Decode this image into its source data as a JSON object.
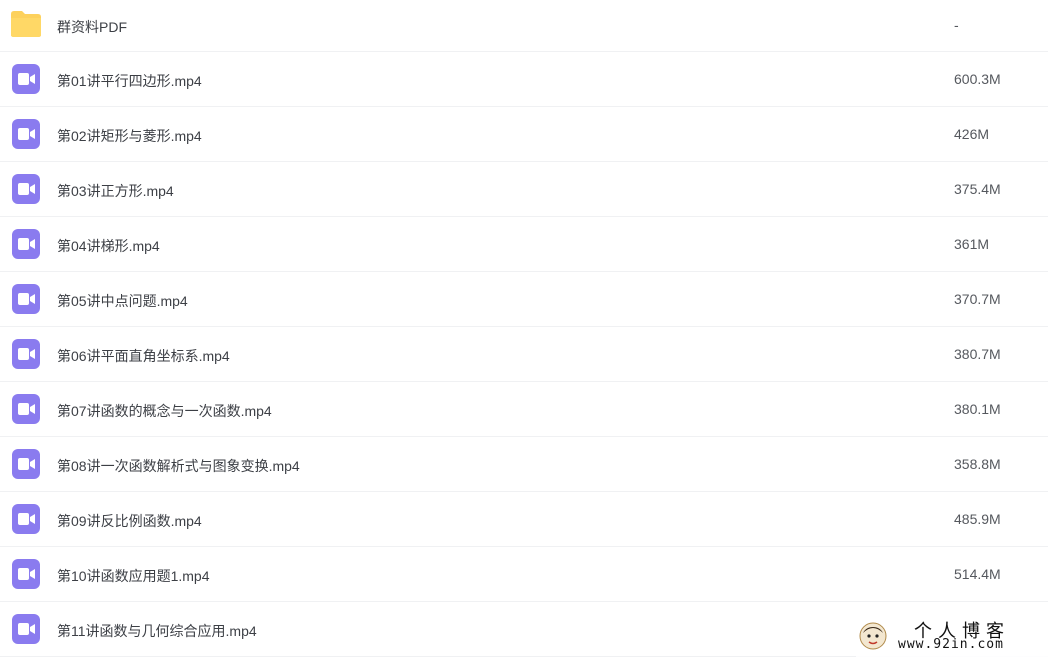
{
  "files": [
    {
      "type": "folder",
      "icon": "folder-icon",
      "name": "群资料PDF",
      "size": "-"
    },
    {
      "type": "video",
      "icon": "video-file-icon",
      "name": "第01讲平行四边形.mp4",
      "size": "600.3M"
    },
    {
      "type": "video",
      "icon": "video-file-icon",
      "name": "第02讲矩形与菱形.mp4",
      "size": "426M"
    },
    {
      "type": "video",
      "icon": "video-file-icon",
      "name": "第03讲正方形.mp4",
      "size": "375.4M"
    },
    {
      "type": "video",
      "icon": "video-file-icon",
      "name": "第04讲梯形.mp4",
      "size": "361M"
    },
    {
      "type": "video",
      "icon": "video-file-icon",
      "name": "第05讲中点问题.mp4",
      "size": "370.7M"
    },
    {
      "type": "video",
      "icon": "video-file-icon",
      "name": "第06讲平面直角坐标系.mp4",
      "size": "380.7M"
    },
    {
      "type": "video",
      "icon": "video-file-icon",
      "name": "第07讲函数的概念与一次函数.mp4",
      "size": "380.1M"
    },
    {
      "type": "video",
      "icon": "video-file-icon",
      "name": "第08讲一次函数解析式与图象变换.mp4",
      "size": "358.8M"
    },
    {
      "type": "video",
      "icon": "video-file-icon",
      "name": "第09讲反比例函数.mp4",
      "size": "485.9M"
    },
    {
      "type": "video",
      "icon": "video-file-icon",
      "name": "第10讲函数应用题1.mp4",
      "size": "514.4M"
    },
    {
      "type": "video",
      "icon": "video-file-icon",
      "name": "第11讲函数与几何综合应用.mp4",
      "size": ""
    }
  ],
  "watermark": {
    "title": "个人博客",
    "url": "www.92in.com"
  },
  "colors": {
    "folder": "#fdd15c",
    "video": "#8a7bef",
    "divider": "#f0f1f3"
  }
}
